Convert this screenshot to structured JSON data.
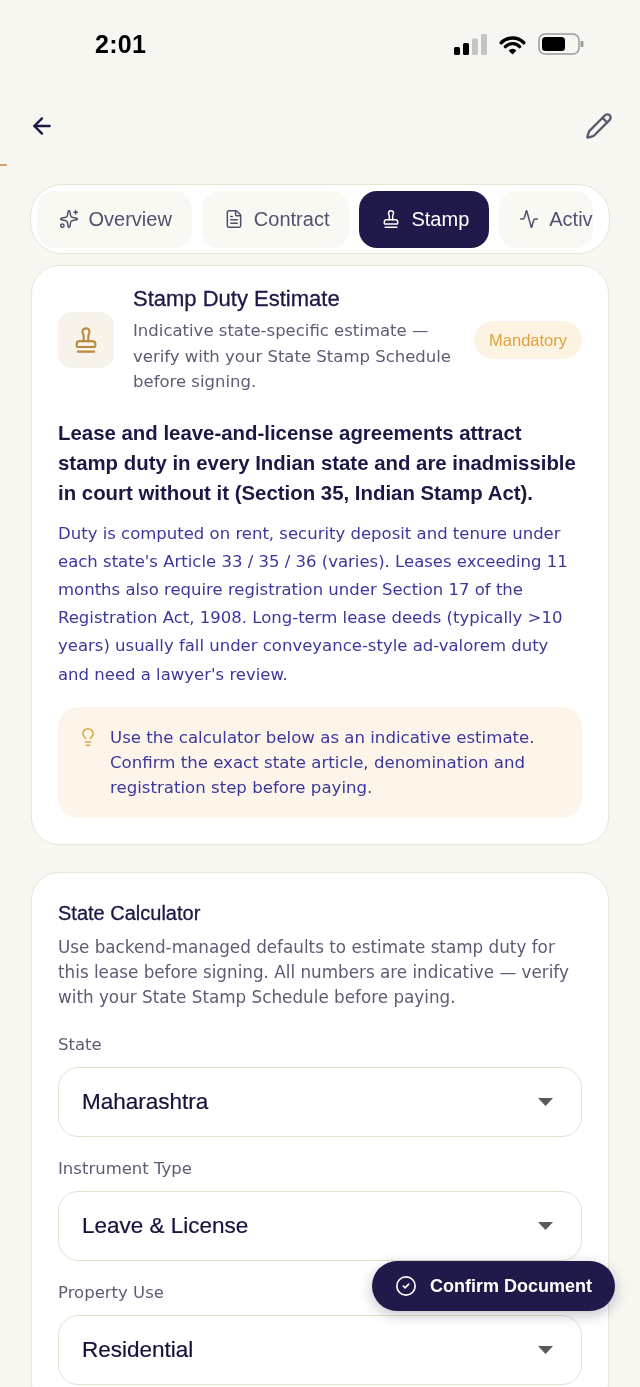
{
  "status_bar": {
    "time": "2:01"
  },
  "tabs": [
    {
      "label": "Overview",
      "selected": false
    },
    {
      "label": "Contract",
      "selected": false
    },
    {
      "label": "Stamp",
      "selected": true
    },
    {
      "label": "Activ",
      "selected": false
    }
  ],
  "stamp_card": {
    "title": "Stamp Duty Estimate",
    "subtitle": "Indicative state-specific estimate — verify with your State Stamp Schedule before signing.",
    "badge": "Mandatory",
    "lead": "Lease and leave-and-license agreements attract stamp duty in every Indian state and are inadmissible in court without it (Section 35, Indian Stamp Act).",
    "body": "Duty is computed on rent, security deposit and tenure under each state's Article 33 / 35 / 36 (varies). Leases exceeding 11 months also require registration under Section 17 of the Registration Act, 1908. Long-term lease deeds (typically >10 years) usually fall under conveyance-style ad-valorem duty and need a lawyer's review.",
    "tip": "Use the calculator below as an indicative estimate. Confirm the exact state article, denomination and registration step before paying."
  },
  "calculator": {
    "title": "State Calculator",
    "description": "Use backend-managed defaults to estimate stamp duty for this lease before signing. All numbers are indicative — verify with your State Stamp Schedule before paying.",
    "fields": [
      {
        "label": "State",
        "value": "Maharashtra"
      },
      {
        "label": "Instrument Type",
        "value": "Leave & License"
      },
      {
        "label": "Property Use",
        "value": "Residential"
      }
    ]
  },
  "confirm_button": {
    "label": "Confirm Document"
  }
}
